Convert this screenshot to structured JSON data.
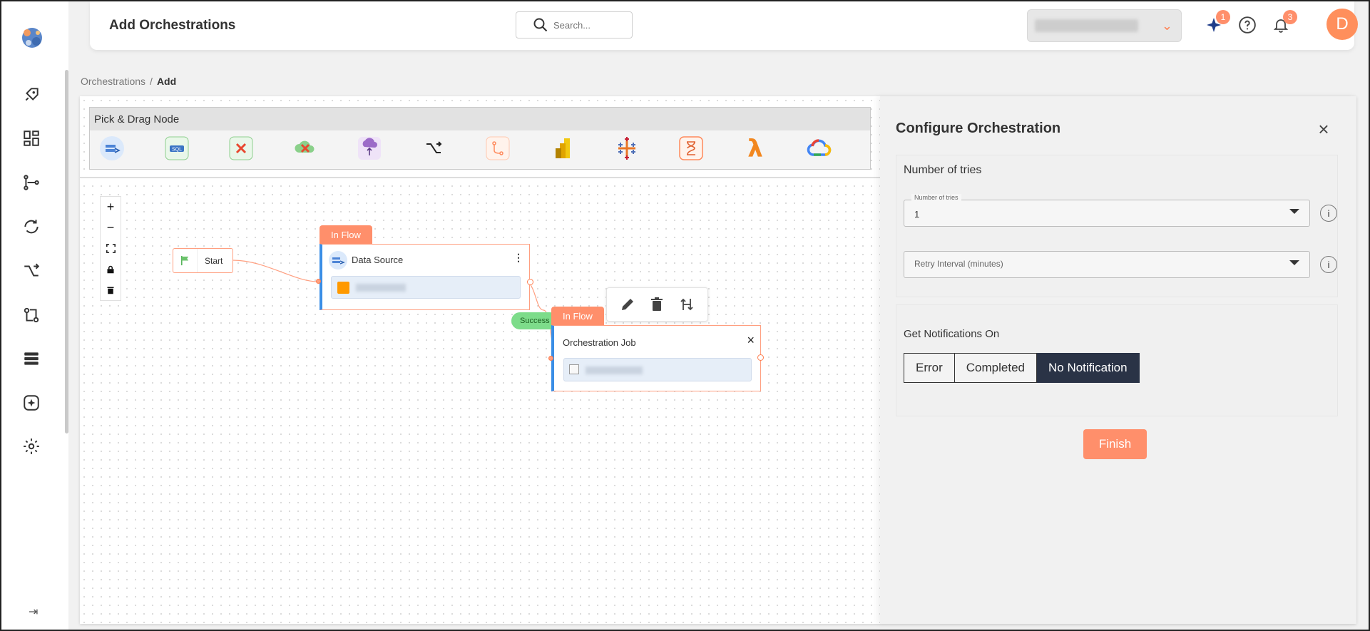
{
  "header": {
    "title": "Add Orchestrations",
    "search_placeholder": "Search...",
    "notifications": {
      "ai_badge": "1",
      "bell_badge": "3"
    },
    "avatar_initial": "D"
  },
  "breadcrumb": {
    "parent": "Orchestrations",
    "separator": "/",
    "current": "Add"
  },
  "palette": {
    "title": "Pick & Drag Node",
    "items": [
      "data-source-icon",
      "sql-icon",
      "data-quality-icon",
      "cloud-cancel-icon",
      "cloud-upload-icon",
      "transform-icon",
      "branch-icon",
      "power-bi-icon",
      "tableau-icon",
      "hourglass-icon",
      "lambda-icon",
      "google-cloud-icon"
    ]
  },
  "flow": {
    "start_label": "Start",
    "node1": {
      "tag": "In Flow",
      "title": "Data Source"
    },
    "success_label": "Success",
    "node2": {
      "tag": "In Flow",
      "title": "Orchestration Job"
    }
  },
  "config": {
    "title": "Configure Orchestration",
    "tries_section": "Number of tries",
    "tries_floating": "Number of tries",
    "tries_value": "1",
    "retry_placeholder": "Retry Interval (minutes)",
    "info_glyph": "i",
    "notif_section": "Get Notifications On",
    "notif_options": [
      "Error",
      "Completed",
      "No Notification"
    ],
    "notif_selected": "No Notification",
    "finish_label": "Finish"
  },
  "colors": {
    "accent": "#ff8f6b",
    "selected": "#2a3346",
    "link_blue": "#3a8ee6",
    "success": "#7ddc8a"
  }
}
